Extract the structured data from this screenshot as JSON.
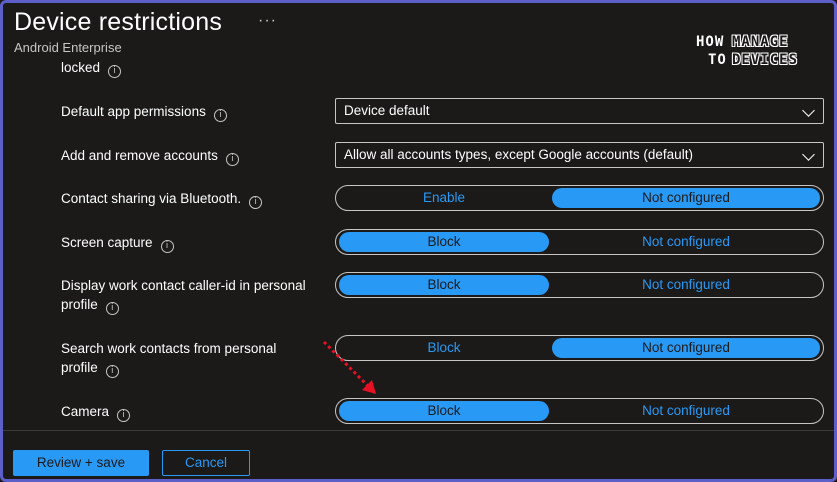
{
  "header": {
    "title": "Device restrictions",
    "more": "···",
    "subtitle": "Android Enterprise"
  },
  "logo": {
    "how": "HOW",
    "to": "TO",
    "manage": "MANAGE",
    "devices": "DEVICES"
  },
  "settings": {
    "locked_label": "locked",
    "default_app_permissions": {
      "label": "Default app permissions",
      "value": "Device default"
    },
    "add_remove_accounts": {
      "label": "Add and remove accounts",
      "value": "Allow all accounts types, except Google accounts (default)"
    },
    "contact_sharing": {
      "label": "Contact sharing via Bluetooth.",
      "left": "Enable",
      "right": "Not configured",
      "selected": "right"
    },
    "screen_capture": {
      "label": "Screen capture",
      "left": "Block",
      "right": "Not configured",
      "selected": "left"
    },
    "caller_id": {
      "label_line1": "Display work contact caller-id in personal",
      "label_line2": "profile",
      "left": "Block",
      "right": "Not configured",
      "selected": "left"
    },
    "search_contacts": {
      "label_line1": "Search work contacts from personal",
      "label_line2": "profile",
      "left": "Block",
      "right": "Not configured",
      "selected": "right"
    },
    "camera": {
      "label": "Camera",
      "left": "Block",
      "right": "Not configured",
      "selected": "left"
    }
  },
  "info_glyph": "i",
  "footer": {
    "review_save": "Review + save",
    "cancel": "Cancel"
  },
  "colors": {
    "accent": "#2899f5",
    "background": "#1b1a19",
    "frame": "#5b5fc7",
    "arrow": "#e81123"
  }
}
